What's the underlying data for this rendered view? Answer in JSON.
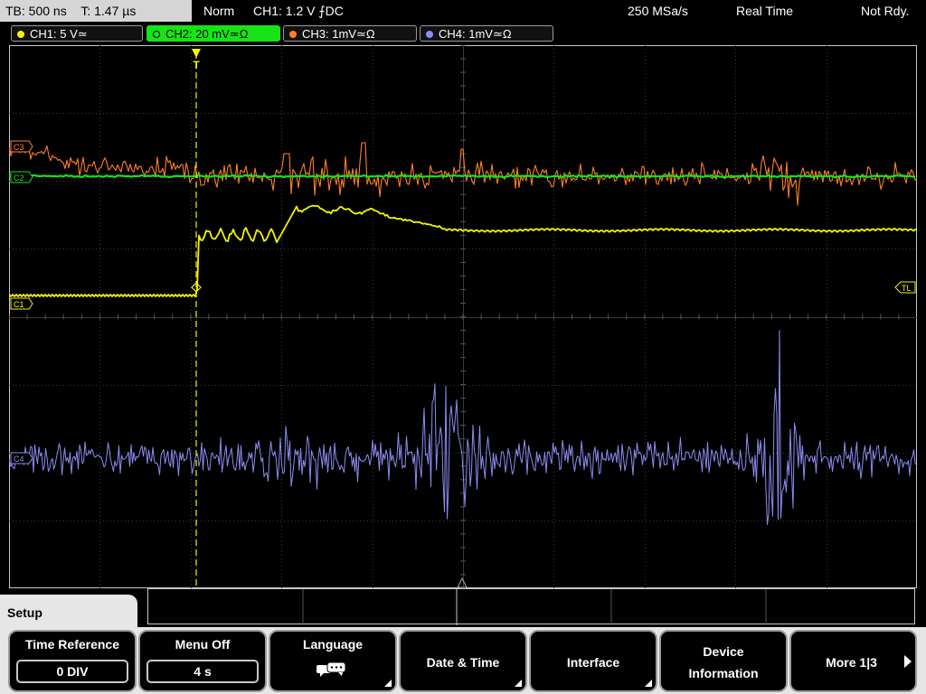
{
  "status": {
    "timebase": "TB: 500 ns",
    "trigger_time": "T: 1.47 µs",
    "mode": "Norm",
    "trigger": "CH1: 1.2 V ⨍DC",
    "sample_rate": "250 MSa/s",
    "acq_mode": "Real Time",
    "state": "Not Rdy."
  },
  "channels": [
    {
      "label": "CH1: 5 V≃",
      "color": "#f5f500"
    },
    {
      "label": "CH2: 20 mV≃Ω",
      "color": "#16e416",
      "active": true
    },
    {
      "label": "CH3: 1mV≃Ω",
      "color": "#ff7f27"
    },
    {
      "label": "CH4: 1mV≃Ω",
      "color": "#8c8cf0"
    }
  ],
  "plot": {
    "markers": {
      "ch1": "C1",
      "ch2": "C2",
      "ch3": "C3",
      "ch4": "C4",
      "trigger_level": "TL",
      "trigger_position": "T"
    },
    "colors": {
      "ch1": "#f5f500",
      "ch2": "#16e416",
      "ch3": "#ff7f27",
      "ch4": "#8c8cf0",
      "grid": "#3a3a3a"
    }
  },
  "menu": {
    "title": "Setup",
    "softkeys": [
      {
        "label": "Time Reference",
        "value": "0 DIV"
      },
      {
        "label": "Menu Off",
        "value": "4 s"
      },
      {
        "label": "Language",
        "icon": "speech-bubbles-icon"
      },
      {
        "label": "Date & Time"
      },
      {
        "label": "Interface"
      },
      {
        "label_line1": "Device",
        "label_line2": "Information"
      },
      {
        "label": "More 1|3"
      }
    ]
  }
}
